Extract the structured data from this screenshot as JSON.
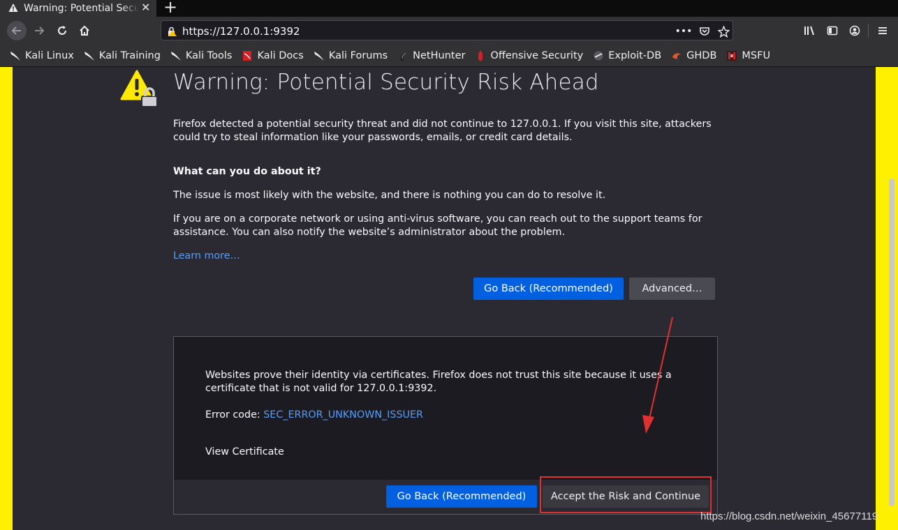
{
  "tab": {
    "title": "Warning: Potential Security Risk Ahead",
    "close": "✕",
    "new_tab": "+"
  },
  "nav": {
    "url": "https://127.0.0.1:9392",
    "page_actions": "•••"
  },
  "bookmarks": [
    {
      "label": "Kali Linux",
      "icon": "kali-dragon-icon"
    },
    {
      "label": "Kali Training",
      "icon": "kali-dragon-icon"
    },
    {
      "label": "Kali Tools",
      "icon": "kali-dragon-icon"
    },
    {
      "label": "Kali Docs",
      "icon": "kali-docs-icon"
    },
    {
      "label": "Kali Forums",
      "icon": "kali-dragon-icon"
    },
    {
      "label": "NetHunter",
      "icon": "nethunter-icon"
    },
    {
      "label": "Offensive Security",
      "icon": "offsec-icon"
    },
    {
      "label": "Exploit-DB",
      "icon": "exploitdb-icon"
    },
    {
      "label": "GHDB",
      "icon": "ghdb-icon"
    },
    {
      "label": "MSFU",
      "icon": "msfu-icon"
    }
  ],
  "warning": {
    "title": "Warning: Potential Security Risk Ahead",
    "intro": "Firefox detected a potential security threat and did not continue to 127.0.0.1. If you visit this site, attackers could try to steal information like your passwords, emails, or credit card details.",
    "what_heading": "What can you do about it?",
    "issue_text": "The issue is most likely with the website, and there is nothing you can do to resolve it.",
    "corporate_text": "If you are on a corporate network or using anti-virus software, you can reach out to the support teams for assistance. You can also notify the website’s administrator about the problem.",
    "learn_more": "Learn more…",
    "go_back_label": "Go Back (Recommended)",
    "advanced_label": "Advanced…"
  },
  "advanced": {
    "cert_text": "Websites prove their identity via certificates. Firefox does not trust this site because it uses a certificate that is not valid for 127.0.0.1:9392.",
    "error_prefix": "Error code: ",
    "error_code": "SEC_ERROR_UNKNOWN_ISSUER",
    "view_certificate": "View Certificate",
    "go_back_label": "Go Back (Recommended)",
    "accept_label": "Accept the Risk and Continue"
  },
  "watermark": "https://blog.csdn.net/weixin_45677119",
  "colors": {
    "accent_blue": "#0060df",
    "link_blue": "#5a9cf8",
    "highlight_red": "#e03030",
    "page_border_yellow": "#fff000"
  }
}
